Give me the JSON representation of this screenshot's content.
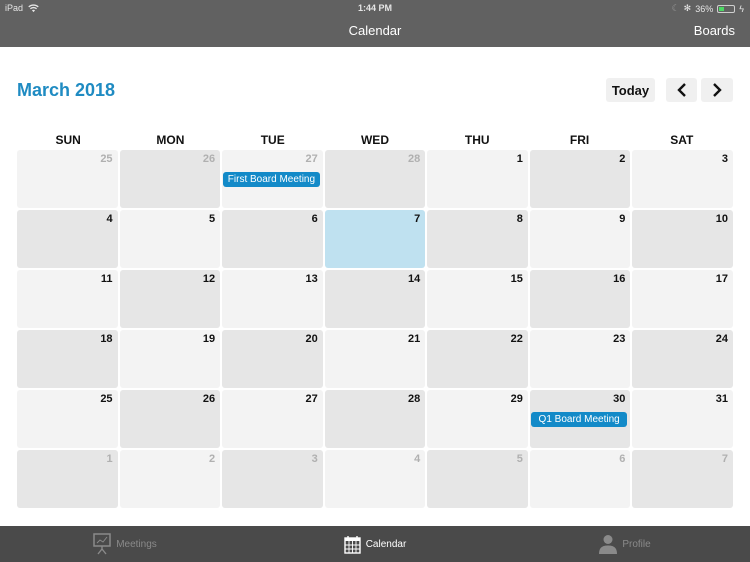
{
  "status_bar": {
    "device": "iPad",
    "time": "1:44 PM",
    "battery_percent_label": "36%",
    "battery_level": 0.36,
    "icons": [
      "wifi-icon",
      "moon-icon",
      "bluetooth-icon",
      "battery-icon",
      "charging-icon"
    ]
  },
  "nav": {
    "title": "Calendar",
    "right_button": "Boards"
  },
  "calendar": {
    "month_title": "March 2018",
    "today_button": "Today",
    "prev_icon": "chevron-left-icon",
    "next_icon": "chevron-right-icon",
    "weekdays": [
      "SUN",
      "MON",
      "TUE",
      "WED",
      "THU",
      "FRI",
      "SAT"
    ],
    "selected_day": 7,
    "weeks": [
      [
        {
          "day": "25",
          "current": false
        },
        {
          "day": "26",
          "current": false
        },
        {
          "day": "27",
          "current": false,
          "event": "First Board Meeting"
        },
        {
          "day": "28",
          "current": false
        },
        {
          "day": "1",
          "current": true
        },
        {
          "day": "2",
          "current": true
        },
        {
          "day": "3",
          "current": true
        }
      ],
      [
        {
          "day": "4",
          "current": true
        },
        {
          "day": "5",
          "current": true
        },
        {
          "day": "6",
          "current": true
        },
        {
          "day": "7",
          "current": true,
          "today": true
        },
        {
          "day": "8",
          "current": true
        },
        {
          "day": "9",
          "current": true
        },
        {
          "day": "10",
          "current": true
        }
      ],
      [
        {
          "day": "11",
          "current": true
        },
        {
          "day": "12",
          "current": true
        },
        {
          "day": "13",
          "current": true
        },
        {
          "day": "14",
          "current": true
        },
        {
          "day": "15",
          "current": true
        },
        {
          "day": "16",
          "current": true
        },
        {
          "day": "17",
          "current": true
        }
      ],
      [
        {
          "day": "18",
          "current": true
        },
        {
          "day": "19",
          "current": true
        },
        {
          "day": "20",
          "current": true
        },
        {
          "day": "21",
          "current": true
        },
        {
          "day": "22",
          "current": true
        },
        {
          "day": "23",
          "current": true
        },
        {
          "day": "24",
          "current": true
        }
      ],
      [
        {
          "day": "25",
          "current": true
        },
        {
          "day": "26",
          "current": true
        },
        {
          "day": "27",
          "current": true
        },
        {
          "day": "28",
          "current": true
        },
        {
          "day": "29",
          "current": true
        },
        {
          "day": "30",
          "current": true,
          "event": "Q1 Board Meeting"
        },
        {
          "day": "31",
          "current": true
        }
      ],
      [
        {
          "day": "1",
          "current": false
        },
        {
          "day": "2",
          "current": false
        },
        {
          "day": "3",
          "current": false
        },
        {
          "day": "4",
          "current": false
        },
        {
          "day": "5",
          "current": false
        },
        {
          "day": "6",
          "current": false
        },
        {
          "day": "7",
          "current": false
        }
      ]
    ]
  },
  "tab_bar": {
    "tabs": [
      {
        "label": "Meetings",
        "icon": "presentation-board-icon",
        "active": false
      },
      {
        "label": "Calendar",
        "icon": "calendar-icon",
        "active": true
      },
      {
        "label": "Profile",
        "icon": "person-icon",
        "active": false
      }
    ]
  },
  "colors": {
    "accent": "#1f8bc2",
    "event": "#138ac8",
    "today_cell": "#bfe1f0",
    "bar_background": "#616161",
    "tab_bar_background": "#4a4a4a"
  }
}
